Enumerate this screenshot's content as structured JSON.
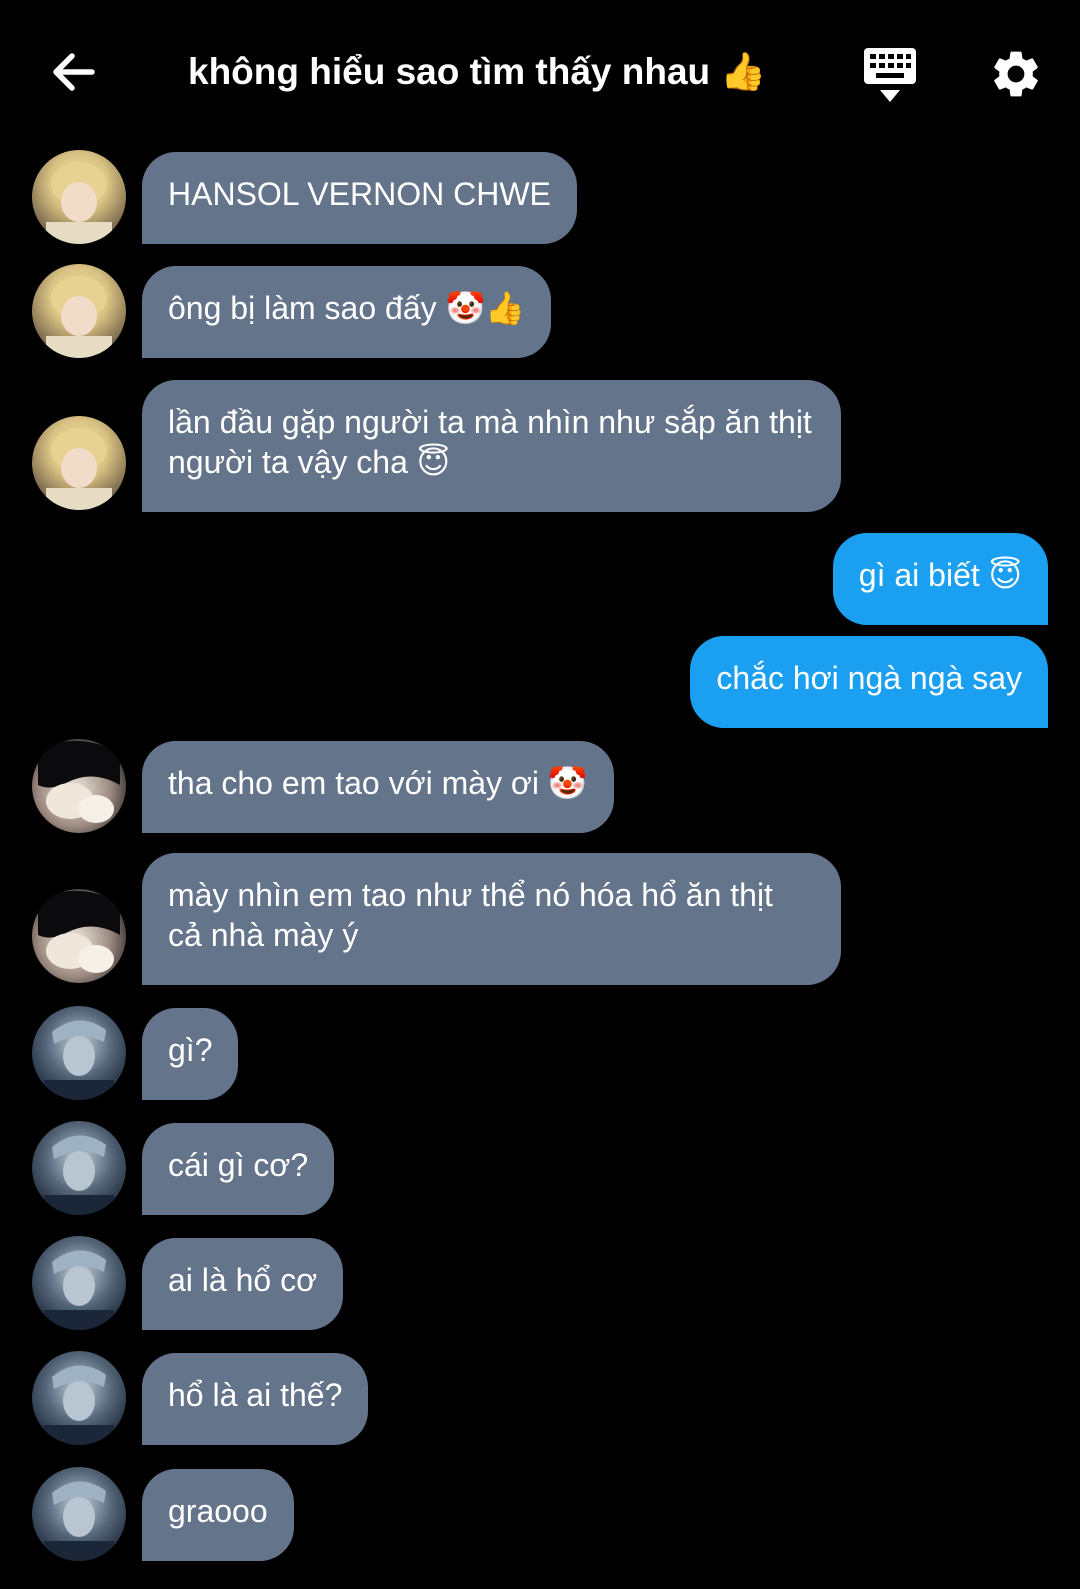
{
  "header": {
    "title": "không hiểu sao tìm thấy nhau 👍"
  },
  "colors": {
    "background": "#000000",
    "incoming_bubble": "#64748a",
    "outgoing_bubble": "#1b9ff0",
    "text": "#ffffff"
  },
  "icons": {
    "back": "arrow-left-icon",
    "keyboard": "keyboard-hide-icon",
    "settings": "gear-icon"
  },
  "messages": [
    {
      "sender": "blonde-avatar",
      "text": "HANSOL VERNON CHWE"
    },
    {
      "sender": "blonde-avatar",
      "text": "ông bị làm sao đấy 🤡👍"
    },
    {
      "sender": "blonde-avatar",
      "text": "lần đầu gặp người ta mà nhìn như sắp ăn thịt người ta vậy cha 😇"
    },
    {
      "sender": "me",
      "text": "gì ai biết 😇"
    },
    {
      "sender": "me",
      "text": "chắc hơi ngà ngà say"
    },
    {
      "sender": "dark-hair-avatar",
      "text": "tha cho em tao với mày ơi 🤡"
    },
    {
      "sender": "dark-hair-avatar",
      "text": "mày nhìn em tao như thể nó hóa hổ ăn thịt cả nhà mày ý"
    },
    {
      "sender": "bandana-avatar",
      "text": "gì?"
    },
    {
      "sender": "bandana-avatar",
      "text": "cái gì cơ?"
    },
    {
      "sender": "bandana-avatar",
      "text": "ai là hổ cơ"
    },
    {
      "sender": "bandana-avatar",
      "text": "hổ là ai thế?"
    },
    {
      "sender": "bandana-avatar",
      "text": "graooo"
    }
  ]
}
